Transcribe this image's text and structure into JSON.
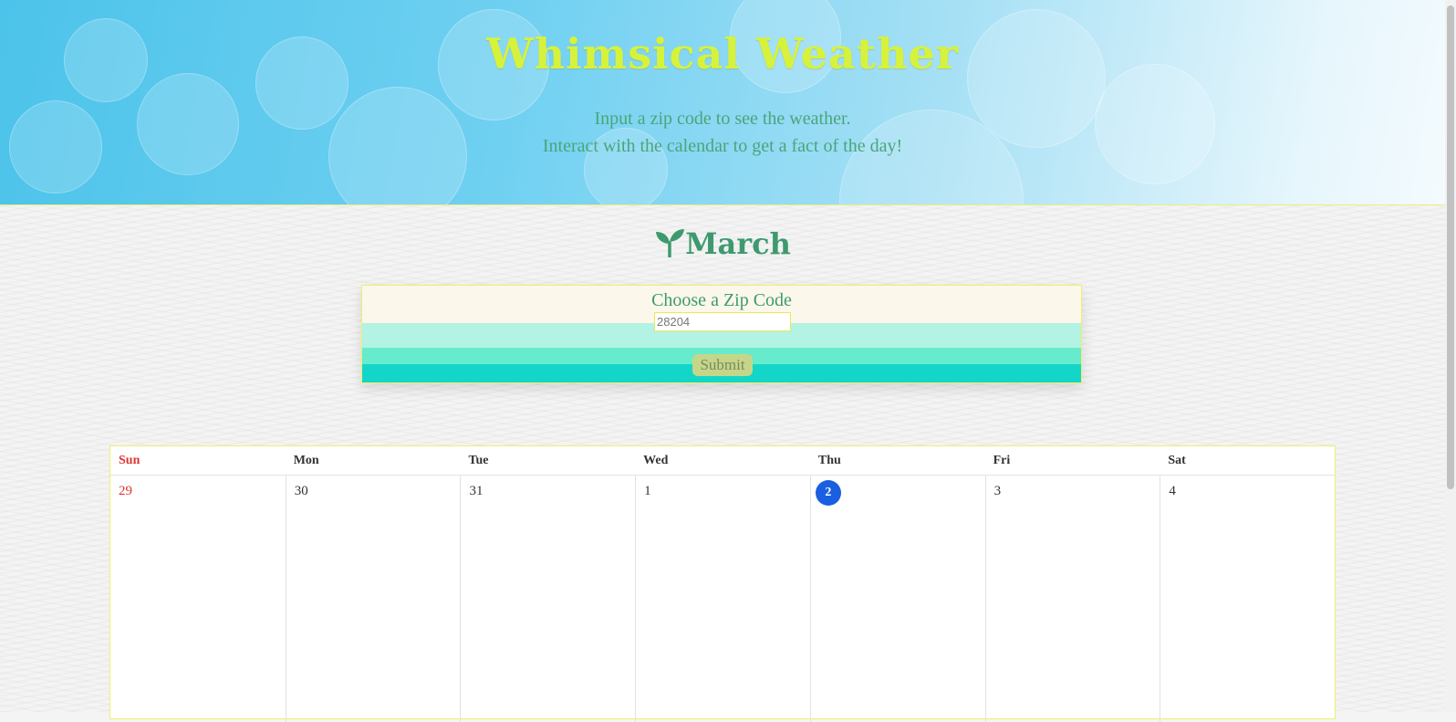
{
  "header": {
    "title": "Whimsical Weather",
    "subtitle_line1": "Input a zip code to see the weather.",
    "subtitle_line2": "Interact with the calendar to get a fact of the day!"
  },
  "month": {
    "name": "March",
    "icon": "sprout-icon"
  },
  "zip_form": {
    "label": "Choose a Zip Code",
    "value": "28204",
    "placeholder": "28204",
    "submit_label": "Submit"
  },
  "calendar": {
    "days": [
      "Sun",
      "Mon",
      "Tue",
      "Wed",
      "Thu",
      "Fri",
      "Sat"
    ],
    "week1": [
      "29",
      "30",
      "31",
      "1",
      "2",
      "3",
      "4"
    ],
    "today": "2"
  },
  "colors": {
    "title": "#d7f23b",
    "accent_green": "#3e9a6e",
    "sunday_red": "#e0332f",
    "today_blue": "#1a5fe0"
  }
}
